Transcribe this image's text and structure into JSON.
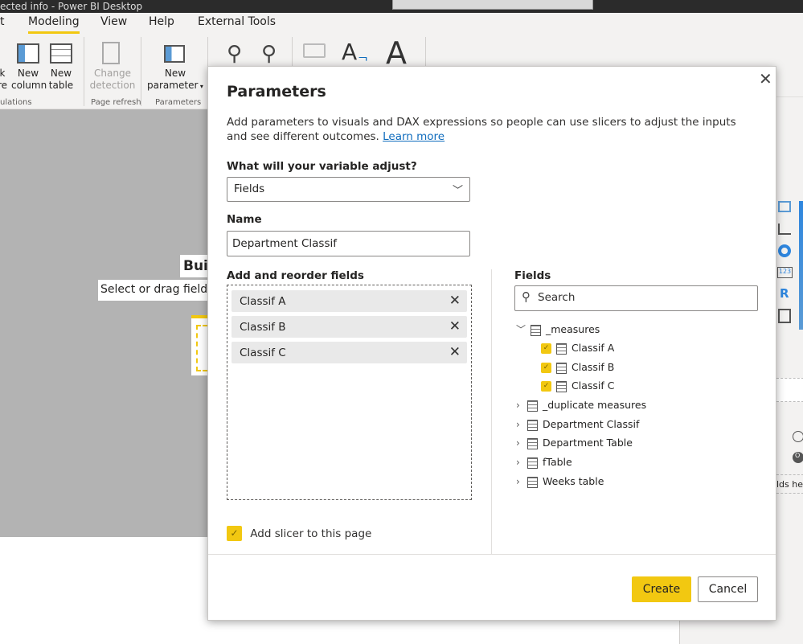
{
  "window": {
    "title": "ected info - Power BI Desktop"
  },
  "ribbon": {
    "tabs": [
      {
        "label": "t"
      },
      {
        "label": "Modeling",
        "active": true
      },
      {
        "label": "View"
      },
      {
        "label": "Help"
      },
      {
        "label": "External Tools"
      }
    ],
    "buttons": {
      "new_measure": "k\nre",
      "new_column": "New\ncolumn",
      "new_table": "New\ntable",
      "change_detection": "Change\ndetection",
      "new_parameter": "New\nparameter"
    },
    "groups": {
      "calculations": "ulations",
      "page_refresh": "Page refresh",
      "parameters": "Parameters"
    }
  },
  "canvas": {
    "build_title": "Buil",
    "build_hint": "Select or drag fields"
  },
  "right_pane": {
    "drop_hint": "lds her",
    "toggle_label": "O"
  },
  "dialog": {
    "title": "Parameters",
    "description": "Add parameters to visuals and DAX expressions so people can use slicers to adjust the inputs and see different outcomes.",
    "learn_more": "Learn more",
    "variable_label": "What will your variable adjust?",
    "variable_value": "Fields",
    "name_label": "Name",
    "name_value": "Department Classif",
    "reorder_label": "Add and reorder fields",
    "selected_fields": [
      "Classif A",
      "Classif B",
      "Classif C"
    ],
    "fields_label": "Fields",
    "search_placeholder": "Search",
    "tree": {
      "measures": {
        "label": "_measures",
        "children": [
          {
            "label": "Classif A",
            "checked": true
          },
          {
            "label": "Classif B",
            "checked": true
          },
          {
            "label": "Classif C",
            "checked": true
          }
        ]
      },
      "tables": [
        {
          "label": "_duplicate measures"
        },
        {
          "label": "Department Classif"
        },
        {
          "label": "Department Table"
        },
        {
          "label": "fTable"
        },
        {
          "label": "Weeks table"
        }
      ]
    },
    "add_slicer_label": "Add slicer to this page",
    "add_slicer_checked": true,
    "create_label": "Create",
    "cancel_label": "Cancel"
  },
  "colors": {
    "accent": "#f2c811",
    "canvas": "#b3b3b3",
    "link": "#0f6cbd"
  }
}
